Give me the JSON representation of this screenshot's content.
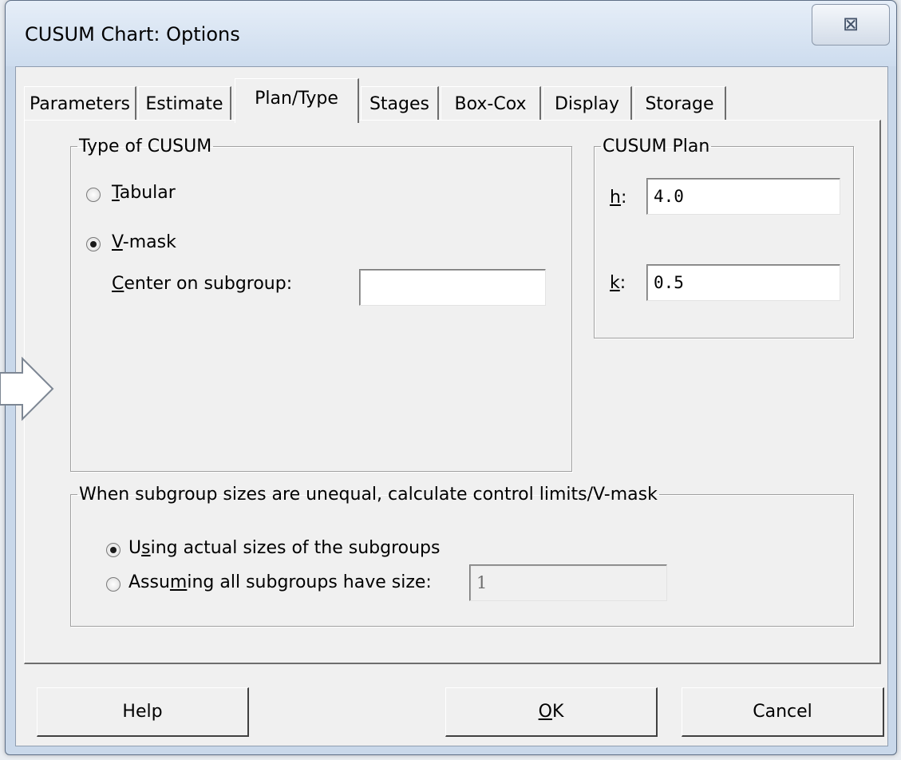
{
  "window": {
    "title": "CUSUM Chart: Options",
    "close_glyph": "⊠"
  },
  "tabs": [
    {
      "label": "Parameters"
    },
    {
      "label": "Estimate"
    },
    {
      "label": "Plan/Type"
    },
    {
      "label": "Stages"
    },
    {
      "label": "Box-Cox"
    },
    {
      "label": "Display"
    },
    {
      "label": "Storage"
    }
  ],
  "active_tab": "Plan/Type",
  "type_of_cusum": {
    "legend": "Type of CUSUM",
    "options": [
      {
        "label_pre": "",
        "label_key": "T",
        "label_post": "abular",
        "selected": false
      },
      {
        "label_pre": "",
        "label_key": "V",
        "label_post": "-mask",
        "selected": true
      }
    ],
    "center_label_key": "C",
    "center_label_post": "enter on subgroup:",
    "center_value": ""
  },
  "cusum_plan": {
    "legend": "CUSUM Plan",
    "h_key": "h",
    "h_suffix": ":",
    "h_value": "4.0",
    "k_key": "k",
    "k_suffix": ":",
    "k_value": "0.5"
  },
  "unequal": {
    "legend": "When subgroup sizes are unequal, calculate control limits/V-mask",
    "options": [
      {
        "label_pre": "U",
        "label_key": "s",
        "label_post": "ing actual sizes of the subgroups",
        "selected": true
      },
      {
        "label_pre": "Assu",
        "label_key": "m",
        "label_post": "ing all subgroups have size:",
        "selected": false
      }
    ],
    "size_value": "1"
  },
  "buttons": {
    "help": "Help",
    "ok_key": "O",
    "ok_post": "K",
    "cancel": "Cancel"
  },
  "colors": {
    "dialog_face": "#f0f0f0",
    "frame": "#c9d8ea",
    "arrow_fill": "#ffffff",
    "arrow_stroke": "#7d8794"
  }
}
